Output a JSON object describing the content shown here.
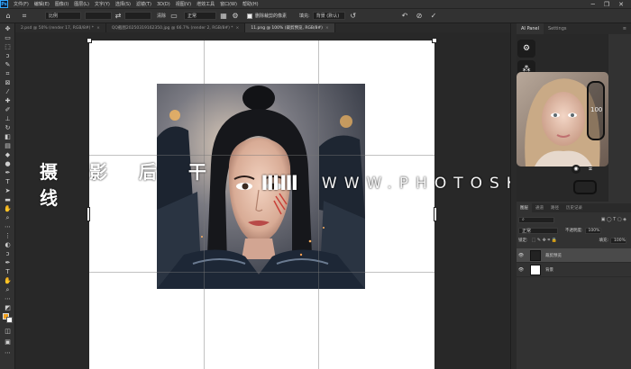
{
  "menubar": {
    "logo": "Ps",
    "items": [
      "文件(F)",
      "编辑(E)",
      "图像(I)",
      "图层(L)",
      "文字(Y)",
      "选择(S)",
      "滤镜(T)",
      "3D(D)",
      "视图(V)",
      "增效工具",
      "窗口(W)",
      "帮助(H)"
    ],
    "window_buttons": [
      "─",
      "❐",
      "✕"
    ]
  },
  "options": {
    "ratio_value": "比例",
    "clear_label": "清除",
    "mode_value": "正常",
    "delete_cropped_label": "删除裁剪的像素",
    "fill_label": "填充:",
    "fill_value": "背景 (默认)"
  },
  "tabs": [
    {
      "label": "2.psd @ 50% (render 17, RGB/8#) *",
      "active": false
    },
    {
      "label": "QQ截图20250319162350.jpg @ 66.7% (render 2, RGB/8#) *",
      "active": false
    },
    {
      "label": "11.png @ 100% (裁剪预览, RGB/8#)",
      "active": true
    }
  ],
  "watermark": {
    "left_text": "摄 影 后 干 线",
    "logo_glyph": "ⅢⅢ",
    "right_text": "WWW.PHOTOSKS.VIP"
  },
  "panels": {
    "ai_tab": "AI Panel",
    "settings_tab": "Settings",
    "phone_value": "100",
    "layer_tabs": [
      "图层",
      "通道",
      "路径",
      "历史记录"
    ],
    "blend_mode": "正常",
    "opacity_label": "不透明度:",
    "opacity_value": "100%",
    "fill_label": "填充:",
    "fill_value": "100%",
    "lock_label": "锁定:",
    "layers": [
      {
        "name": "裁剪预览",
        "selected": true
      },
      {
        "name": "背景",
        "selected": false
      }
    ]
  },
  "colors": {
    "foreground": "#f0a020",
    "background": "#ffffff",
    "accent": "#31a8ff"
  }
}
